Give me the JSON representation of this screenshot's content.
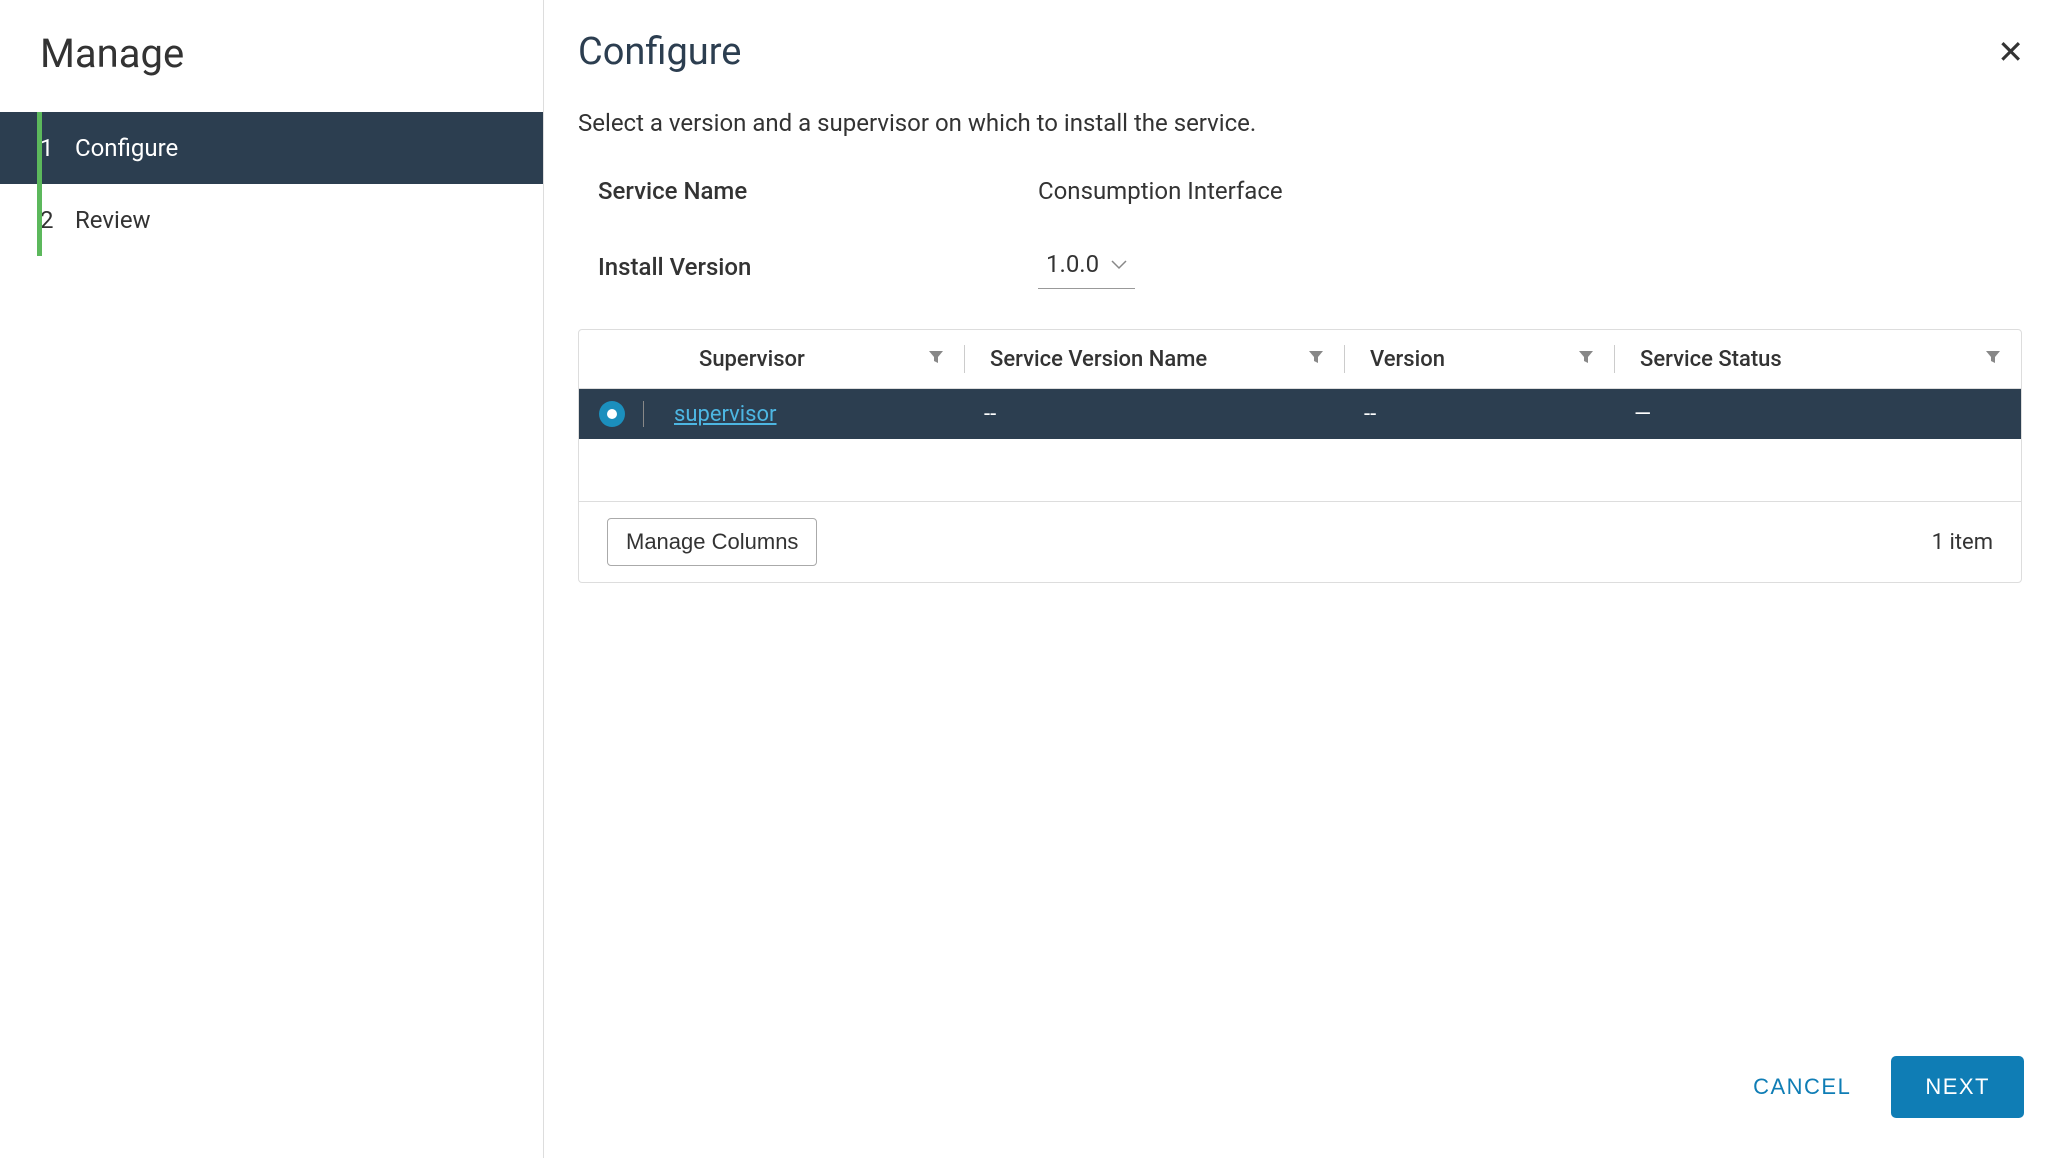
{
  "sidebar": {
    "title": "Manage",
    "steps": [
      {
        "num": "1",
        "label": "Configure",
        "active": true
      },
      {
        "num": "2",
        "label": "Review",
        "active": false
      }
    ]
  },
  "header": {
    "title": "Configure"
  },
  "description": "Select a version and a supervisor on which to install the service.",
  "form": {
    "service_name_label": "Service Name",
    "service_name_value": "Consumption Interface",
    "install_version_label": "Install Version",
    "install_version_value": "1.0.0"
  },
  "table": {
    "columns": {
      "supervisor": "Supervisor",
      "service_version_name": "Service Version Name",
      "version": "Version",
      "service_status": "Service Status"
    },
    "rows": [
      {
        "supervisor": "supervisor",
        "service_version_name": "--",
        "version": "--",
        "service_status": "—"
      }
    ],
    "manage_columns_label": "Manage Columns",
    "item_count": "1 item"
  },
  "footer": {
    "cancel": "CANCEL",
    "next": "NEXT"
  }
}
